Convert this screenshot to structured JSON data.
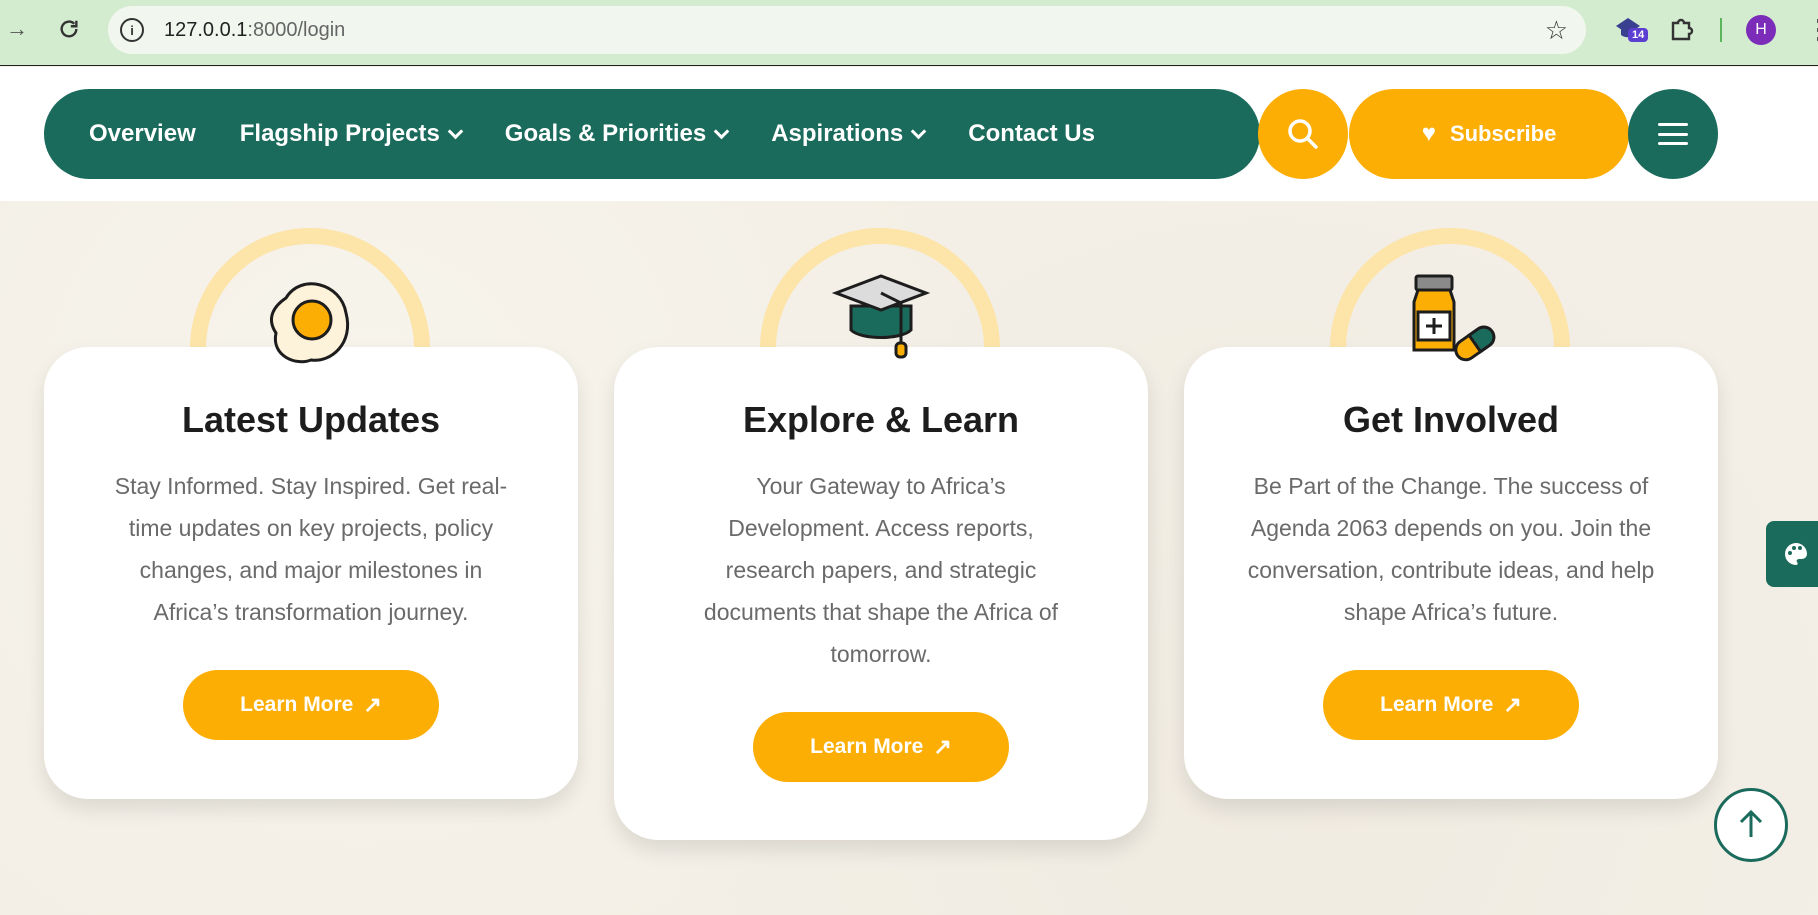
{
  "browser": {
    "url_host": "127.0.0.1",
    "url_path": ":8000/login",
    "extension_badge": "14",
    "profile_initial": "H",
    "icons": [
      "forward-icon",
      "reload-icon",
      "info-icon",
      "star-icon",
      "extension-icon",
      "puzzle-icon",
      "menu-dots-icon"
    ]
  },
  "nav": {
    "items": [
      {
        "label": "Overview",
        "has_dropdown": false
      },
      {
        "label": "Flagship Projects",
        "has_dropdown": true
      },
      {
        "label": "Goals & Priorities",
        "has_dropdown": true
      },
      {
        "label": "Aspirations",
        "has_dropdown": true
      },
      {
        "label": "Contact Us",
        "has_dropdown": false
      }
    ],
    "subscribe_label": "Subscribe",
    "colors": {
      "primary": "#1b6b5c",
      "accent": "#fcae05"
    }
  },
  "cards": [
    {
      "icon": "fried-egg-icon",
      "title": "Latest Updates",
      "text": "Stay Informed. Stay Inspired. Get real-time updates on key projects, policy changes, and major milestones in Africa’s transformation journey.",
      "button": "Learn More"
    },
    {
      "icon": "graduation-cap-icon",
      "title": "Explore & Learn",
      "text": "Your Gateway to Africa’s Development. Access reports, research papers, and strategic documents that shape the Africa of tomorrow.",
      "button": "Learn More"
    },
    {
      "icon": "medicine-bottle-icon",
      "title": "Get Involved",
      "text": "Be Part of the Change. The success of Agenda 2063 depends on you. Join the conversation, contribute ideas, and help shape Africa’s future.",
      "button": "Learn More"
    }
  ]
}
